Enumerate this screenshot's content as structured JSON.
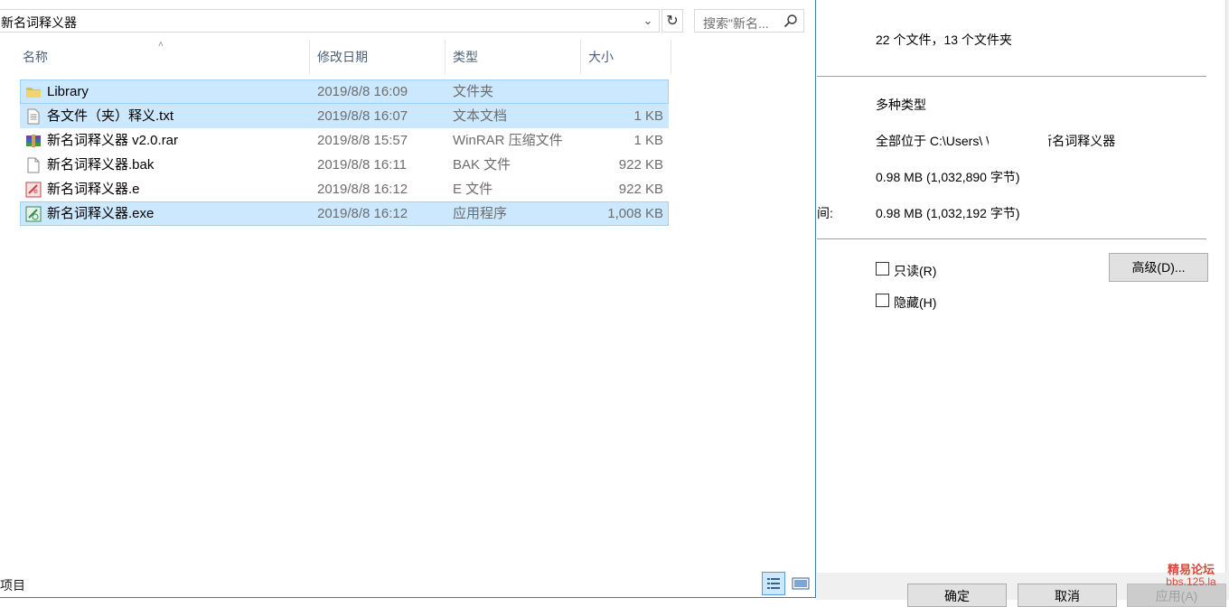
{
  "explorer": {
    "address": "新名词释义器",
    "search_placeholder": "搜索\"新名...",
    "columns": {
      "name": "名称",
      "date": "修改日期",
      "type": "类型",
      "size": "大小"
    },
    "files": [
      {
        "name": "Library",
        "date": "2019/8/8 16:09",
        "type": "文件夹",
        "size": "",
        "icon": "folder-icon"
      },
      {
        "name": "各文件（夹）释义.txt",
        "date": "2019/8/8 16:07",
        "type": "文本文档",
        "size": "1 KB",
        "icon": "text-file-icon"
      },
      {
        "name": "新名词释义器 v2.0.rar",
        "date": "2019/8/8 15:57",
        "type": "WinRAR 压缩文件",
        "size": "1 KB",
        "icon": "winrar-archive-icon"
      },
      {
        "name": "新名词释义器.bak",
        "date": "2019/8/8 16:11",
        "type": "BAK 文件",
        "size": "922 KB",
        "icon": "blank-file-icon"
      },
      {
        "name": "新名词释义器.e",
        "date": "2019/8/8 16:12",
        "type": "E 文件",
        "size": "922 KB",
        "icon": "e-file-icon"
      },
      {
        "name": "新名词释义器.exe",
        "date": "2019/8/8 16:12",
        "type": "应用程序",
        "size": "1,008 KB",
        "icon": "exe-file-icon"
      }
    ],
    "status": "项目"
  },
  "properties": {
    "contains": "22 个文件，13 个文件夹",
    "type": "多种类型",
    "location": "全部位于 C:\\Users\\        \\Desktop\\新名词释义器",
    "size": "0.98 MB (1,032,890 字节)",
    "size_on_disk_label": "间:",
    "size_on_disk": "0.98 MB (1,032,192 字节)",
    "readonly_label": "只读(R)",
    "hidden_label": "隐藏(H)",
    "advanced_button": "高级(D)...",
    "ok_button": "确定",
    "cancel_button": "取消",
    "apply_button": "应用(A)"
  },
  "watermark": {
    "line1": "精易论坛",
    "line2": "bbs.125.la"
  }
}
